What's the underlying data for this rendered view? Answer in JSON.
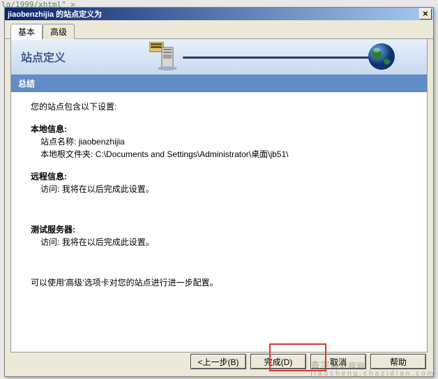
{
  "bg_fragment": "lg/1999/xhtml\" >",
  "titlebar": "jiaobenzhijia 的站点定义为",
  "tabs": {
    "basic": "基本",
    "advanced": "高级"
  },
  "header": {
    "title": "站点定义"
  },
  "section_bar": "总结",
  "content": {
    "intro": "您的站点包含以下设置:",
    "local": {
      "title": "本地信息:",
      "site_name_label": "站点名称:",
      "site_name_value": "jiaobenzhijia",
      "root_label": "本地根文件夹:",
      "root_value": "C:\\Documents and Settings\\Administrator\\桌面\\jb51\\"
    },
    "remote": {
      "title": "远程信息:",
      "access_label": "访问:",
      "access_value": "我将在以后完成此设置。"
    },
    "test": {
      "title": "测试服务器:",
      "access_label": "访问:",
      "access_value": "我将在以后完成此设置。"
    },
    "note": "可以使用'高级'选项卡对您的站点进行进一步配置。"
  },
  "buttons": {
    "back": "<上一步(B)",
    "finish": "完成(D)",
    "cancel": "取消",
    "help": "帮助"
  },
  "watermark": {
    "main": "查字典",
    "sub": "jiaocheng.chazidian.com"
  }
}
